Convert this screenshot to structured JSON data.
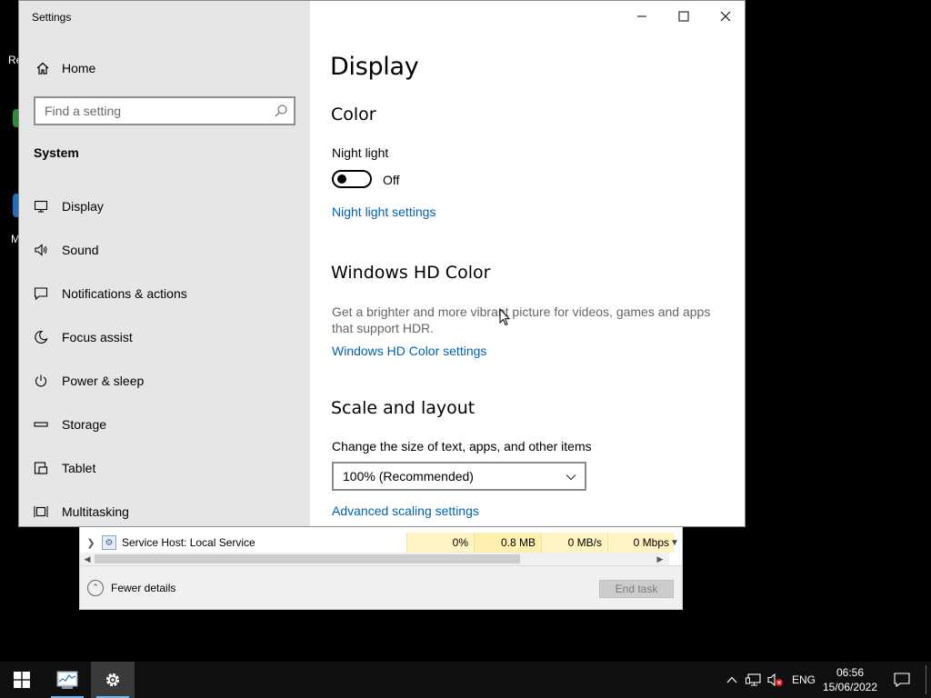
{
  "settings": {
    "window_title": "Settings",
    "sidebar": {
      "home_label": "Home",
      "search_placeholder": "Find a setting",
      "section_label": "System",
      "items": [
        {
          "label": "Display",
          "icon": "monitor-icon"
        },
        {
          "label": "Sound",
          "icon": "speaker-icon"
        },
        {
          "label": "Notifications & actions",
          "icon": "notification-icon"
        },
        {
          "label": "Focus assist",
          "icon": "moon-icon"
        },
        {
          "label": "Power & sleep",
          "icon": "power-icon"
        },
        {
          "label": "Storage",
          "icon": "storage-icon"
        },
        {
          "label": "Tablet",
          "icon": "tablet-icon"
        },
        {
          "label": "Multitasking",
          "icon": "multitasking-icon"
        }
      ]
    },
    "main": {
      "page_title": "Display",
      "color": {
        "heading": "Color",
        "night_light_label": "Night light",
        "night_light_state": "Off",
        "night_light_link": "Night light settings"
      },
      "hd_color": {
        "heading": "Windows HD Color",
        "description": "Get a brighter and more vibrant picture for videos, games and apps that support HDR.",
        "link": "Windows HD Color settings"
      },
      "scale_layout": {
        "heading": "Scale and layout",
        "size_label": "Change the size of text, apps, and other items",
        "size_value": "100% (Recommended)",
        "advanced_link": "Advanced scaling settings"
      }
    }
  },
  "task_manager": {
    "process_name": "Service Host: Local Service",
    "cpu": "0%",
    "memory": "0.8 MB",
    "disk": "0 MB/s",
    "network": "0 Mbps",
    "fewer_details_label": "Fewer details",
    "end_task_label": "End task"
  },
  "desktop": {
    "fragment_1": "Re",
    "fragment_2": "M"
  },
  "taskbar": {
    "language": "ENG",
    "time": "06:56",
    "date": "15/06/2022"
  },
  "colors": {
    "accent_link": "#0063b1",
    "sidebar_bg": "#e6e6e6",
    "taskbar_bg": "#101010",
    "cpu_highlight": "#fff4c4"
  }
}
